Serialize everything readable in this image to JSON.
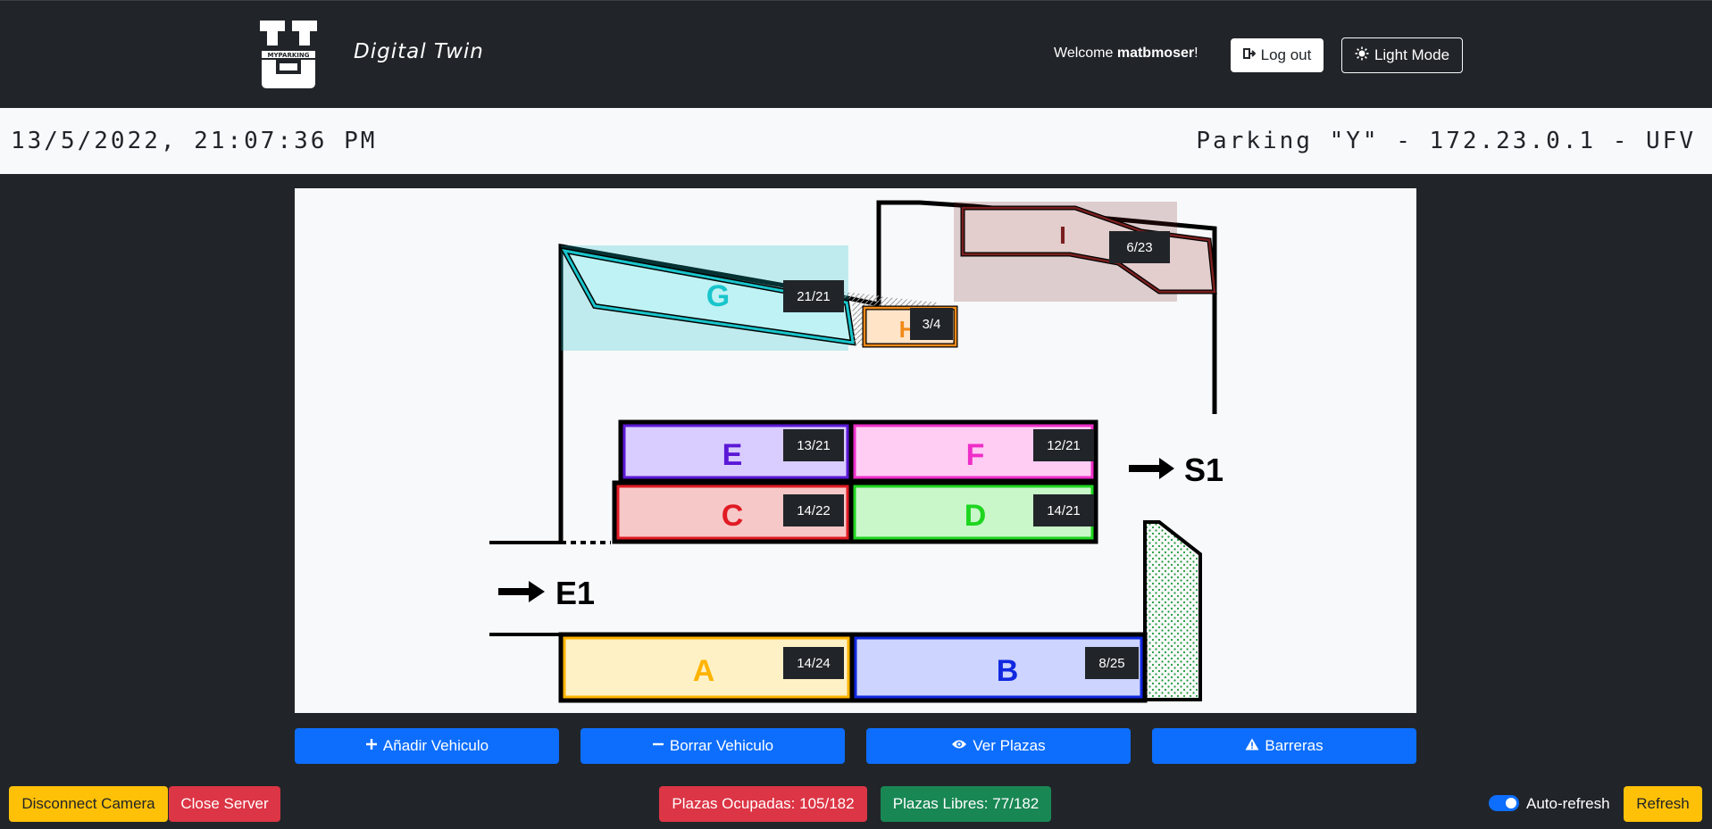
{
  "header": {
    "logo_text": "MYPARKING",
    "title": "Digital Twin",
    "welcome_prefix": "Welcome ",
    "username": "matbmoser",
    "welcome_suffix": "!",
    "logout_label": "Log out",
    "light_mode_label": "Light Mode"
  },
  "info": {
    "datetime": "13/5/2022, 21:07:36 PM",
    "parking": "Parking \"Y\" - 172.23.0.1 - UFV"
  },
  "map": {
    "zones": [
      {
        "id": "G",
        "label": "G",
        "count": "21/21",
        "color": "#19c5cc"
      },
      {
        "id": "H",
        "label": "H",
        "count": "3/4",
        "color": "#f08a18"
      },
      {
        "id": "I",
        "label": "I",
        "count": "6/23",
        "color": "#7a1f1f"
      },
      {
        "id": "E",
        "label": "E",
        "count": "13/21",
        "color": "#5b18d6"
      },
      {
        "id": "F",
        "label": "F",
        "count": "12/21",
        "color": "#ee2ec8"
      },
      {
        "id": "C",
        "label": "C",
        "count": "14/22",
        "color": "#e01b24"
      },
      {
        "id": "D",
        "label": "D",
        "count": "14/21",
        "color": "#1ed620"
      },
      {
        "id": "A",
        "label": "A",
        "count": "14/24",
        "color": "#ffb400"
      },
      {
        "id": "B",
        "label": "B",
        "count": "8/25",
        "color": "#1028e0"
      }
    ],
    "entry_label": "E1",
    "exit_label": "S1"
  },
  "actions": {
    "add": "Añadir Vehiculo",
    "delete": "Borrar Vehiculo",
    "view": "Ver Plazas",
    "barriers": "Barreras"
  },
  "footer": {
    "disconnect": "Disconnect Camera",
    "close": "Close Server",
    "occupied": "Plazas Ocupadas: 105/182",
    "free": "Plazas Libres: 77/182",
    "auto_refresh": "Auto-refresh",
    "refresh": "Refresh"
  },
  "colors": {
    "primary": "#0d6efd",
    "warning": "#ffc107",
    "danger": "#dc3545",
    "success": "#198754",
    "dark": "#212529"
  }
}
